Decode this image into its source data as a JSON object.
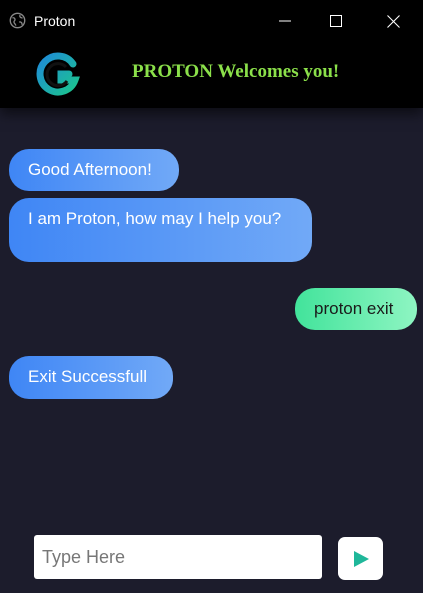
{
  "window": {
    "title": "Proton",
    "icon": "globe-icon",
    "controls": [
      "minimize-icon",
      "maximize-icon",
      "close-icon"
    ]
  },
  "header": {
    "logo": "g-logo-icon",
    "welcome_text": "PROTON Welcomes you!",
    "welcome_color": "#8be04a"
  },
  "messages": [
    {
      "from": "bot",
      "text": "Good Afternoon!"
    },
    {
      "from": "bot",
      "text": "I am Proton, how may I help you?"
    },
    {
      "from": "user",
      "text": "proton exit"
    },
    {
      "from": "bot",
      "text": "Exit Successfull"
    }
  ],
  "input": {
    "placeholder": "Type Here",
    "value": ""
  },
  "send_button": {
    "icon": "send-play-icon",
    "color": "#1fb79a"
  },
  "colors": {
    "background": "#1c1c2c",
    "bot_bubble": "#3f86f5",
    "user_bubble": "#42e39b"
  }
}
